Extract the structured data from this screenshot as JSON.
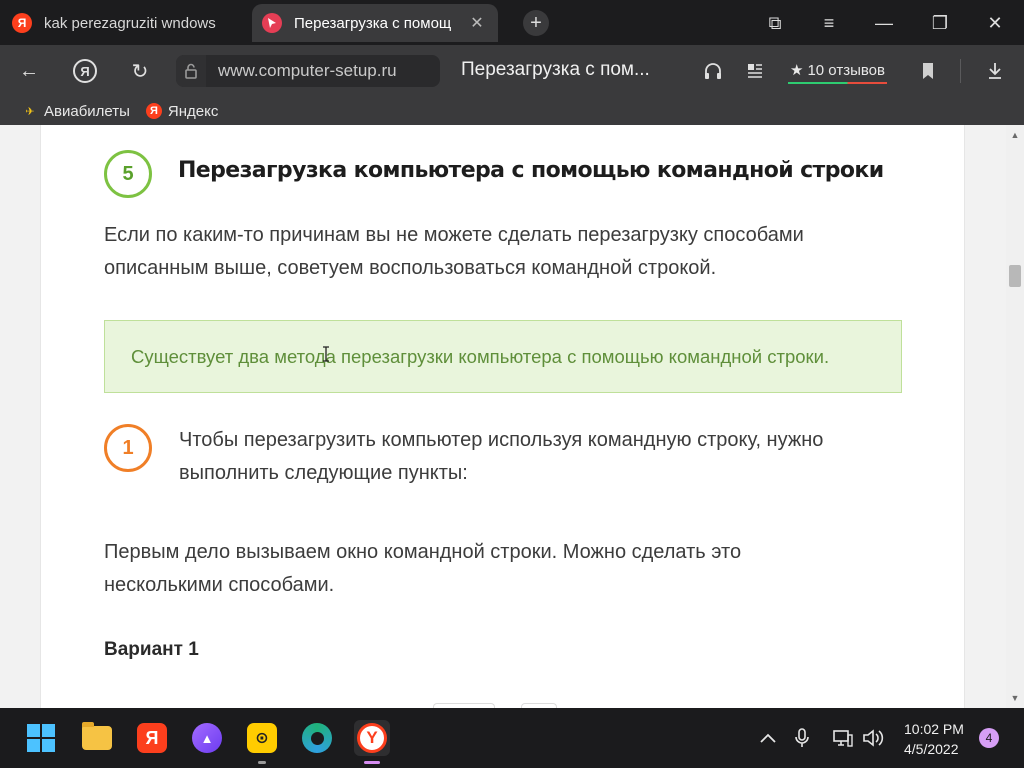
{
  "browser": {
    "tabs": [
      {
        "title": "kak perezagruziti wndows",
        "favicon": "yandex-icon"
      },
      {
        "title": "Перезагрузка с помощ",
        "favicon": "computer-setup-icon",
        "active": true
      }
    ],
    "new_tab_symbol": "+",
    "window_controls": {
      "bookmarks": "⧉",
      "menu": "≡",
      "minimize": "—",
      "maximize": "❐",
      "close": "✕"
    },
    "nav": {
      "back": "←",
      "yandex": "Я",
      "reload": "↻",
      "lock": "🔒"
    },
    "url": "www.computer-setup.ru",
    "page_title": "Перезагрузка с пом...",
    "reviews": {
      "star": "★",
      "label": "10 отзывов"
    },
    "tools": {
      "headphones": "🎧",
      "reader": "☰",
      "bookmark": "🔖",
      "download": "⭳"
    },
    "bookmarks": [
      {
        "label": "Авиабилеты",
        "icon": "plane-icon",
        "glyph": "✈"
      },
      {
        "label": "Яндекс",
        "icon": "yandex-icon",
        "glyph": "Я"
      }
    ]
  },
  "article": {
    "step5": {
      "number": "5",
      "heading": "Перезагрузка компьютера с помощью командной строки"
    },
    "intro": "Если по каким-то причинам вы не можете сделать перезагрузку способами описанным выше, советуем воспользоваться командной строкой.",
    "notice": "Существует два метода перезагрузки компьютера с помощью командной строки.",
    "step1": {
      "number": "1",
      "text": "Чтобы перезагрузить компьютер используя командную строку, нужно выполнить следующие пункты:"
    },
    "para2": "Первым дело вызываем окно командной строки. Можно сделать это несколькими способами.",
    "variant_heading": "Вариант 1",
    "colors": {
      "green": "#7dc242",
      "orange": "#f07f27",
      "notice_bg": "#e9f5dc"
    }
  },
  "scrollbar": {
    "up": "▲",
    "down": "▼"
  },
  "taskbar": {
    "apps": [
      "windows-start-icon",
      "file-explorer-icon",
      "yandex-app-icon",
      "alice-icon",
      "yellow-app-icon",
      "edge-icon",
      "yandex-browser-icon"
    ],
    "ya_letter": "Я",
    "tray": {
      "chevron": "⌃",
      "mic": "🎙",
      "network": "🖵",
      "volume": "🔊"
    },
    "time": "10:02 PM",
    "date": "4/5/2022",
    "notifications": "4"
  }
}
